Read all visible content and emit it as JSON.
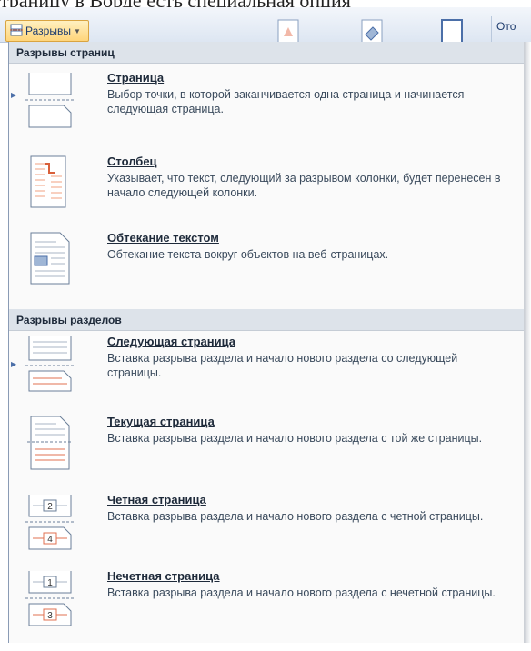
{
  "background_text": "траницу в Ворде есть специальная опция",
  "ribbon": {
    "breaks_label": "Разрывы",
    "trailing_text": "Ото"
  },
  "menu": {
    "page_breaks_header": "Разрывы страниц",
    "section_breaks_header": "Разрывы разделов",
    "items": [
      {
        "title": "Страница",
        "desc": "Выбор точки, в которой заканчивается одна страница и начинается следующая страница."
      },
      {
        "title": "Столбец",
        "desc": "Указывает, что текст, следующий за разрывом колонки, будет перенесен в начало следующей колонки."
      },
      {
        "title": "Обтекание текстом",
        "desc": "Обтекание текста вокруг объектов на веб-страницах."
      },
      {
        "title": "Следующая страница",
        "desc": "Вставка разрыва раздела и начало нового раздела со следующей страницы."
      },
      {
        "title": "Текущая страница",
        "desc": "Вставка разрыва раздела и начало нового раздела с той же страницы."
      },
      {
        "title": "Четная страница",
        "desc": "Вставка разрыва раздела и начало нового раздела с четной страницы."
      },
      {
        "title": "Нечетная страница",
        "desc": "Вставка разрыва раздела и начало нового раздела с нечетной страницы."
      }
    ]
  },
  "icons": {
    "page_break": "page-break-icon",
    "column_break": "column-break-icon",
    "text_wrapping": "text-wrapping-icon",
    "next_page": "next-page-section-icon",
    "continuous": "continuous-section-icon",
    "even_page": "even-page-section-icon",
    "odd_page": "odd-page-section-icon",
    "even_page_number_top": "2",
    "even_page_number_bottom": "4",
    "odd_page_number_top": "1",
    "odd_page_number_bottom": "3"
  },
  "colors": {
    "accent": "#d9603a",
    "header_bg": "#dde3ea",
    "menu_bg": "#fafafa"
  }
}
